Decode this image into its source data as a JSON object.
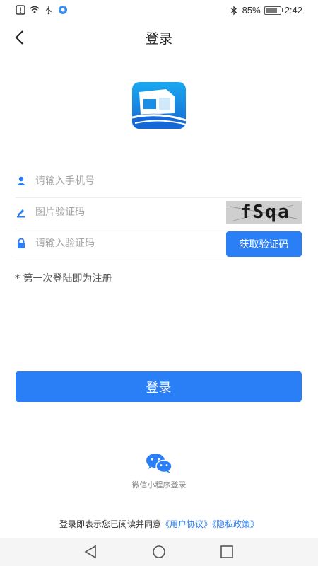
{
  "status_bar": {
    "battery_percent": "85%",
    "time": "2:42",
    "icons": [
      "notification-icon",
      "wifi-icon",
      "usb-icon",
      "app-notification-icon",
      "bluetooth-icon",
      "battery-icon"
    ]
  },
  "header": {
    "title": "登录",
    "back_icon": "chevron-left-icon"
  },
  "logo": {
    "icon": "truck-logo-icon",
    "colors": {
      "bg_top": "#1aa8f0",
      "bg_bottom": "#1469d6"
    }
  },
  "form": {
    "phone": {
      "placeholder": "请输入手机号",
      "icon": "user-icon"
    },
    "image_code": {
      "placeholder": "图片验证码",
      "icon": "pencil-icon",
      "captcha_text": "fSqa"
    },
    "sms_code": {
      "placeholder": "请输入验证码",
      "icon": "lock-icon",
      "button_label": "获取验证码"
    }
  },
  "note": "* 第一次登陆即为注册",
  "login_button": "登录",
  "wechat": {
    "icon": "wechat-icon",
    "label": "微信小程序登录"
  },
  "agreement": {
    "prefix": "登录即表示您已阅读并同意",
    "user_agreement": "《用户协议》",
    "privacy_policy": "《隐私政策》"
  },
  "system_nav": {
    "icons": [
      "back-triangle-icon",
      "home-circle-icon",
      "recents-square-icon"
    ]
  },
  "colors": {
    "accent": "#2a7ef6",
    "divider": "#ececec"
  }
}
